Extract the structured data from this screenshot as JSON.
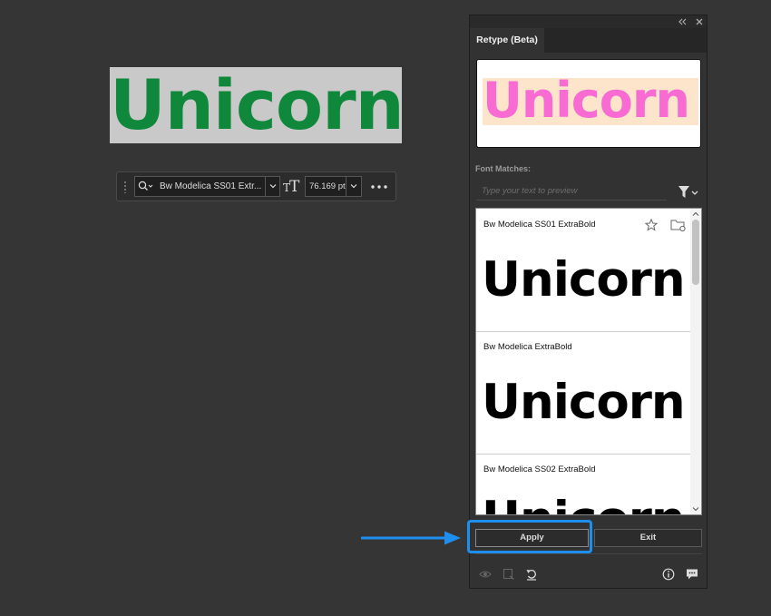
{
  "canvas": {
    "text": "Unicorn",
    "text_color": "#10883b",
    "selection_color": "#c9c9c9"
  },
  "taskbar": {
    "font_name": "Bw Modelica SS01 Extr...",
    "font_size": "76.169 pt"
  },
  "panel": {
    "tab_label": "Retype (Beta)",
    "preview_text": "Unicorn",
    "preview_text_color": "#f76bd2",
    "preview_highlight_color": "#fde5cb",
    "font_matches_label": "Font Matches:",
    "preview_input_placeholder": "Type your text to preview",
    "matches": [
      {
        "name": "Bw Modelica SS01 ExtraBold",
        "sample": "Unicorn"
      },
      {
        "name": "Bw Modelica ExtraBold",
        "sample": "Unicorn"
      },
      {
        "name": "Bw Modelica SS02 ExtraBold",
        "sample": "Unicorn"
      }
    ],
    "apply_label": "Apply",
    "exit_label": "Exit"
  },
  "annotation": {
    "highlight_color": "#1e8fef"
  },
  "icons": [
    "search-icon",
    "chevron-down-icon",
    "text-size-icon",
    "more-options-icon",
    "collapse-icon",
    "close-icon",
    "filter-icon",
    "star-icon",
    "folder-icon",
    "eye-icon",
    "export-icon",
    "reset-icon",
    "info-icon",
    "feedback-icon",
    "arrow-icon"
  ]
}
